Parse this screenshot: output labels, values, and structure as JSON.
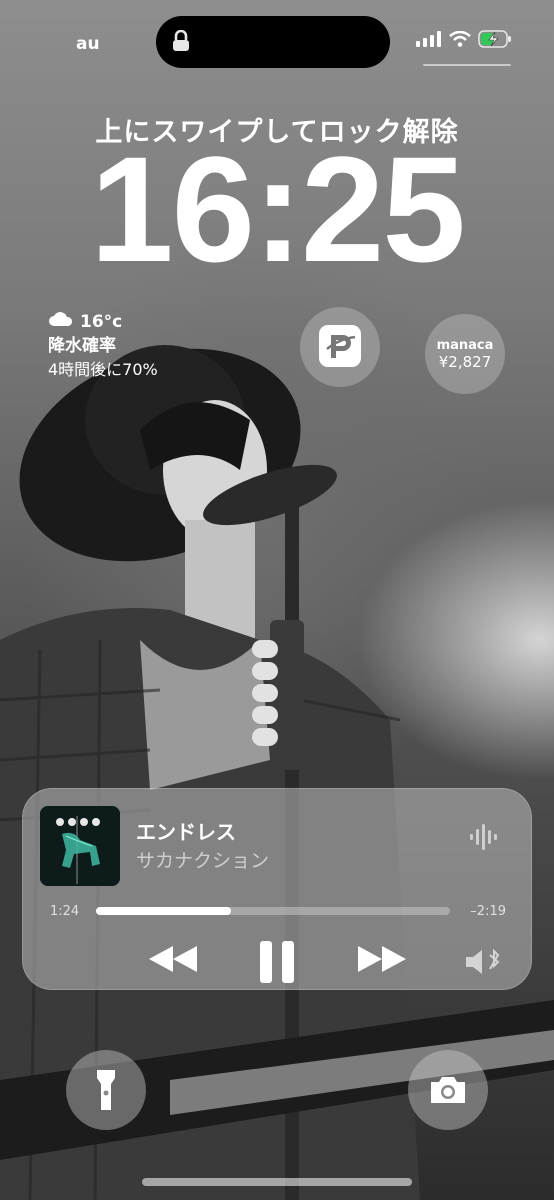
{
  "status": {
    "carrier": "au",
    "icons": [
      "lock-icon",
      "cellular-signal-icon",
      "wifi-icon",
      "battery-charging-icon"
    ]
  },
  "lock": {
    "swipe_hint": "上にスワイプしてロック解除",
    "time": "16:25"
  },
  "weather": {
    "icon": "cloud-icon",
    "temp": "16°c",
    "label": "降水確率",
    "forecast": "4時間後に70%"
  },
  "widgets": {
    "paypay_icon": "paypay-logo-icon",
    "manaca": {
      "name": "manaca",
      "balance": "¥2,827"
    }
  },
  "now_playing": {
    "title": "エンドレス",
    "artist": "サカナクション",
    "elapsed": "1:24",
    "remaining": "–2:19",
    "progress": 0.38,
    "controls": [
      "rewind-icon",
      "pause-icon",
      "fast-forward-icon"
    ],
    "output_icon": "speaker-bluetooth-icon"
  },
  "bottom": {
    "left_icon": "flashlight-icon",
    "right_icon": "camera-icon"
  },
  "colors": {
    "accent": "#ffffff",
    "battery_green": "#34c759"
  }
}
